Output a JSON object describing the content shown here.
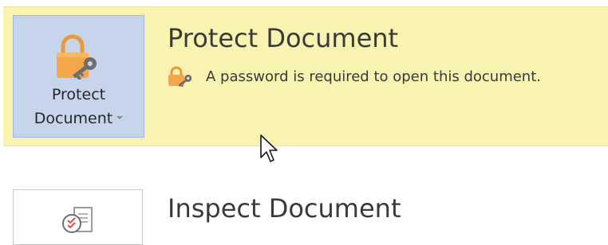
{
  "protect": {
    "tile_label_line1": "Protect",
    "tile_label_line2": "Document",
    "title": "Protect Document",
    "status_text": "A password is required to open this document.",
    "icon": "lock-key-icon",
    "status_icon": "lock-key-icon"
  },
  "inspect": {
    "title": "Inspect Document",
    "icon": "inspect-document-icon"
  },
  "colors": {
    "highlight_band": "#f8f3b0",
    "tile_selected_bg": "#c6d5ec",
    "tile_selected_border": "#9fb7dc",
    "lock_orange": "#f4a64a",
    "key_gray": "#6e6e6e"
  }
}
